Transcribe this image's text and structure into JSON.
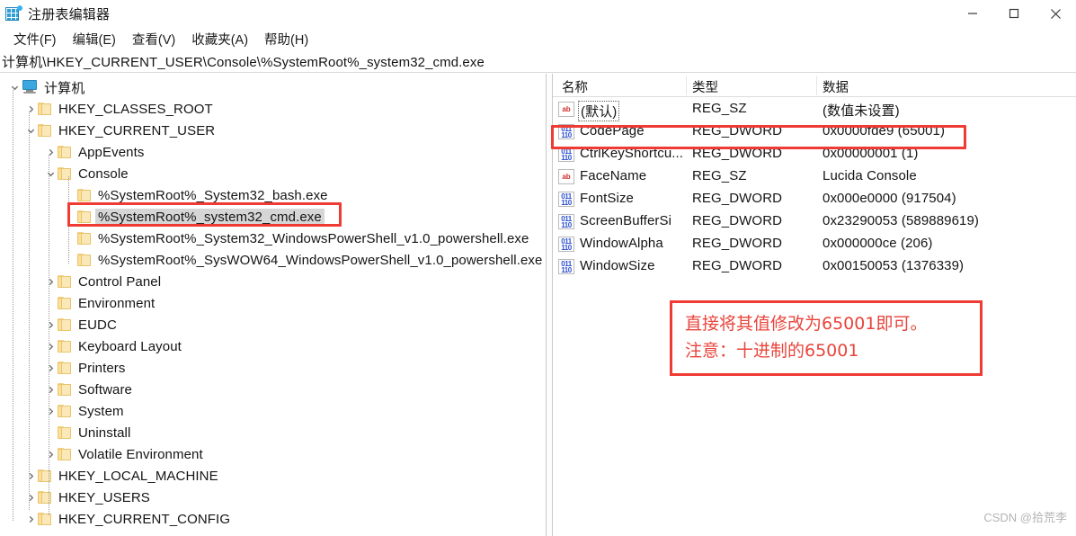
{
  "window": {
    "title": "注册表编辑器",
    "icon": "registry-editor-icon",
    "controls": {
      "minimize": "–",
      "maximize": "☐",
      "close": "✕"
    }
  },
  "menubar": {
    "items": [
      {
        "label": "文件(F)",
        "name": "menu-file"
      },
      {
        "label": "编辑(E)",
        "name": "menu-edit"
      },
      {
        "label": "查看(V)",
        "name": "menu-view"
      },
      {
        "label": "收藏夹(A)",
        "name": "menu-favorites"
      },
      {
        "label": "帮助(H)",
        "name": "menu-help"
      }
    ]
  },
  "address": {
    "path": "计算机\\HKEY_CURRENT_USER\\Console\\%SystemRoot%_system32_cmd.exe"
  },
  "tree": {
    "root_label": "计算机",
    "items": [
      {
        "label": "计算机",
        "depth": 0,
        "twist": "expanded",
        "icon": "computer-icon",
        "selected": false
      },
      {
        "label": "HKEY_CLASSES_ROOT",
        "depth": 1,
        "twist": "collapsed",
        "icon": "folder-icon",
        "selected": false
      },
      {
        "label": "HKEY_CURRENT_USER",
        "depth": 1,
        "twist": "expanded",
        "icon": "folder-icon",
        "selected": false
      },
      {
        "label": "AppEvents",
        "depth": 2,
        "twist": "collapsed",
        "icon": "folder-icon",
        "selected": false
      },
      {
        "label": "Console",
        "depth": 2,
        "twist": "expanded",
        "icon": "folder-icon",
        "selected": false
      },
      {
        "label": "%SystemRoot%_System32_bash.exe",
        "depth": 3,
        "twist": "none",
        "icon": "folder-icon",
        "selected": false
      },
      {
        "label": "%SystemRoot%_system32_cmd.exe",
        "depth": 3,
        "twist": "none",
        "icon": "folder-icon",
        "selected": true
      },
      {
        "label": "%SystemRoot%_System32_WindowsPowerShell_v1.0_powershell.exe",
        "depth": 3,
        "twist": "none",
        "icon": "folder-icon",
        "selected": false
      },
      {
        "label": "%SystemRoot%_SysWOW64_WindowsPowerShell_v1.0_powershell.exe",
        "depth": 3,
        "twist": "none",
        "icon": "folder-icon",
        "selected": false
      },
      {
        "label": "Control Panel",
        "depth": 2,
        "twist": "collapsed",
        "icon": "folder-icon",
        "selected": false
      },
      {
        "label": "Environment",
        "depth": 2,
        "twist": "none",
        "icon": "folder-icon",
        "selected": false
      },
      {
        "label": "EUDC",
        "depth": 2,
        "twist": "collapsed",
        "icon": "folder-icon",
        "selected": false
      },
      {
        "label": "Keyboard Layout",
        "depth": 2,
        "twist": "collapsed",
        "icon": "folder-icon",
        "selected": false
      },
      {
        "label": "Printers",
        "depth": 2,
        "twist": "collapsed",
        "icon": "folder-icon",
        "selected": false
      },
      {
        "label": "Software",
        "depth": 2,
        "twist": "collapsed",
        "icon": "folder-icon",
        "selected": false
      },
      {
        "label": "System",
        "depth": 2,
        "twist": "collapsed",
        "icon": "folder-icon",
        "selected": false
      },
      {
        "label": "Uninstall",
        "depth": 2,
        "twist": "none",
        "icon": "folder-icon",
        "selected": false
      },
      {
        "label": "Volatile Environment",
        "depth": 2,
        "twist": "collapsed",
        "icon": "folder-icon",
        "selected": false
      },
      {
        "label": "HKEY_LOCAL_MACHINE",
        "depth": 1,
        "twist": "collapsed",
        "icon": "folder-icon",
        "selected": false
      },
      {
        "label": "HKEY_USERS",
        "depth": 1,
        "twist": "collapsed",
        "icon": "folder-icon",
        "selected": false
      },
      {
        "label": "HKEY_CURRENT_CONFIG",
        "depth": 1,
        "twist": "collapsed",
        "icon": "folder-icon",
        "selected": false
      }
    ]
  },
  "list": {
    "columns": [
      "名称",
      "类型",
      "数据"
    ],
    "rows": [
      {
        "name": "(默认)",
        "type": "REG_SZ",
        "data": "(数值未设置)",
        "icon": "string-value-icon",
        "highlighted": false,
        "dotted": true
      },
      {
        "name": "CodePage",
        "type": "REG_DWORD",
        "data": "0x0000fde9 (65001)",
        "icon": "dword-value-icon",
        "highlighted": true,
        "dotted": false
      },
      {
        "name": "CtrlKeyShortcu...",
        "type": "REG_DWORD",
        "data": "0x00000001 (1)",
        "icon": "dword-value-icon",
        "highlighted": false,
        "dotted": false
      },
      {
        "name": "FaceName",
        "type": "REG_SZ",
        "data": "Lucida Console",
        "icon": "string-value-icon",
        "highlighted": false,
        "dotted": false
      },
      {
        "name": "FontSize",
        "type": "REG_DWORD",
        "data": "0x000e0000 (917504)",
        "icon": "dword-value-icon",
        "highlighted": false,
        "dotted": false
      },
      {
        "name": "ScreenBufferSi",
        "type": "REG_DWORD",
        "data": "0x23290053 (589889619)",
        "icon": "dword-value-icon",
        "highlighted": false,
        "dotted": false
      },
      {
        "name": "WindowAlpha",
        "type": "REG_DWORD",
        "data": "0x000000ce (206)",
        "icon": "dword-value-icon",
        "highlighted": false,
        "dotted": false
      },
      {
        "name": "WindowSize",
        "type": "REG_DWORD",
        "data": "0x00150053 (1376339)",
        "icon": "dword-value-icon",
        "highlighted": false,
        "dotted": false
      }
    ]
  },
  "annotation": {
    "line1": "直接将其值修改为65001即可。",
    "line2": "注意：十进制的65001"
  },
  "watermark": {
    "text": "CSDN @拾荒李"
  },
  "colors": {
    "accent_red": "#ef3b33",
    "note_text": "#e8453c",
    "folder": "#fcdf9b",
    "selection": "#dcdcdc",
    "reg_sz_icon": "#cf2c2c",
    "reg_dword_icon": "#2b4fd0"
  }
}
